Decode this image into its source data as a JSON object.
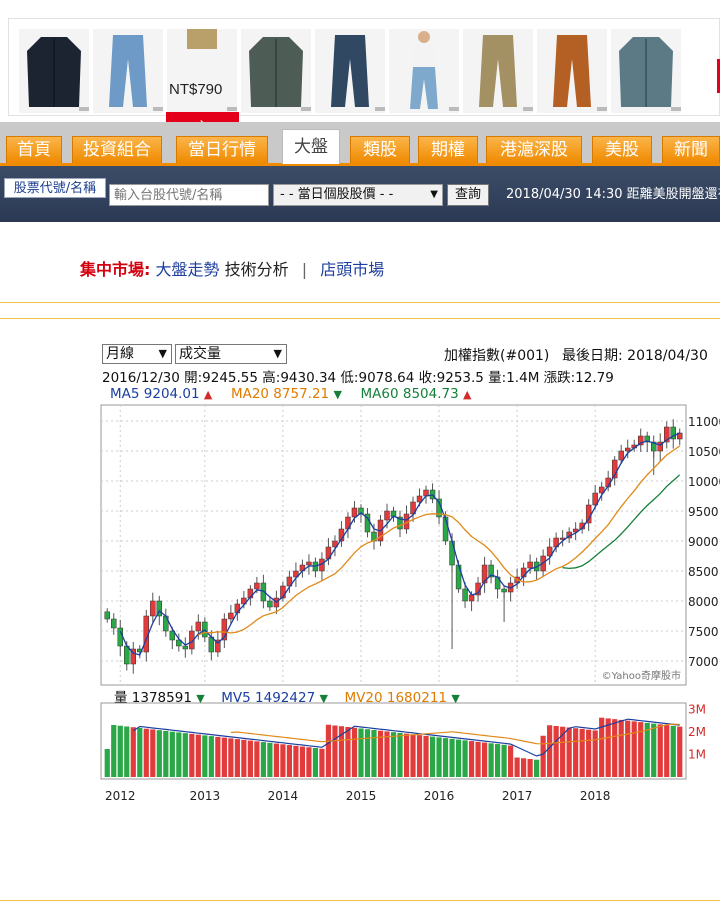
{
  "ad": {
    "price": "NT$790",
    "cta": "›",
    "items": [
      "dark-jacket",
      "light-jeans",
      "khaki-pants",
      "green-jacket",
      "dark-jeans",
      "man-denim",
      "beige-pants",
      "brown-shorts",
      "teal-parka"
    ],
    "colors": [
      "#1b2430",
      "#6d9ac7",
      "#b9a06a",
      "#4e5c56",
      "#304861",
      "#7fa8cd",
      "#a39063",
      "#b45f23",
      "#5c7a86"
    ]
  },
  "tabs": [
    "首頁",
    "投資組合",
    "當日行情",
    "大盤",
    "類股",
    "期權",
    "港滬深股",
    "美股",
    "新聞"
  ],
  "active_tab": "大盤",
  "search": {
    "label": "股票代號/名稱",
    "placeholder": "輸入台股代號/名稱",
    "select": "- - 當日個股股價 - -",
    "button": "查詢",
    "status": "2018/04/30 14:30 距離美股開盤還有"
  },
  "market_nav": {
    "prefix": "集中市場:",
    "trend": "大盤走勢",
    "tech": "技術分析",
    "sep": "|",
    "otc": "店頭市場"
  },
  "chart_header": {
    "period": "月線",
    "indicator": "成交量",
    "index_name": "加權指數(#001)",
    "last_date": "最後日期: 2018/04/30",
    "info": "2016/12/30  開:9245.55  高:9430.34  低:9078.64  收:9253.5  量:1.4M  漲跌:12.79",
    "ma5": "MA5 9204.01",
    "ma20": "MA20 8757.21",
    "ma60": "MA60 8504.73",
    "vol": "量 1378591",
    "mv5": "MV5 1492427",
    "mv20": "MV20 1680211",
    "watermark": "©Yahoo奇摩股市"
  },
  "chart_data": {
    "type": "candlestick",
    "price_axis": {
      "ticks": [
        7000,
        7500,
        8000,
        8500,
        9000,
        9500,
        10000,
        10500,
        11000
      ],
      "ylim": [
        6650,
        11250
      ]
    },
    "volume_axis": {
      "ticks": [
        "1M",
        "2M",
        "3M"
      ],
      "values": [
        1,
        2,
        3
      ],
      "ylim": [
        0,
        3.2
      ]
    },
    "x_labels": [
      "2012",
      "2013",
      "2014",
      "2015",
      "2016",
      "2017",
      "2018"
    ],
    "series_names": [
      "MA5",
      "MA20",
      "MA60",
      "MV5",
      "MV20"
    ],
    "closes": [
      7700,
      7550,
      7250,
      6950,
      7200,
      7150,
      7750,
      8000,
      7750,
      7500,
      7350,
      7250,
      7200,
      7500,
      7650,
      7400,
      7150,
      7350,
      7700,
      7800,
      7950,
      8050,
      8200,
      8300,
      8000,
      7900,
      8050,
      8250,
      8400,
      8500,
      8600,
      8650,
      8500,
      8700,
      8900,
      9000,
      9200,
      9400,
      9550,
      9450,
      9150,
      9000,
      9350,
      9500,
      9400,
      9200,
      9450,
      9650,
      9750,
      9850,
      9700,
      9400,
      9000,
      8600,
      8200,
      8000,
      8100,
      8300,
      8600,
      8400,
      8200,
      8150,
      8300,
      8400,
      8550,
      8650,
      8500,
      8750,
      8900,
      9050,
      9050,
      9150,
      9200,
      9300,
      9600,
      9800,
      9900,
      10050,
      10350,
      10500,
      10550,
      10600,
      10750,
      10650,
      10500,
      10650,
      10900,
      10700,
      10800
    ],
    "vol_low": [
      "1M"
    ]
  }
}
